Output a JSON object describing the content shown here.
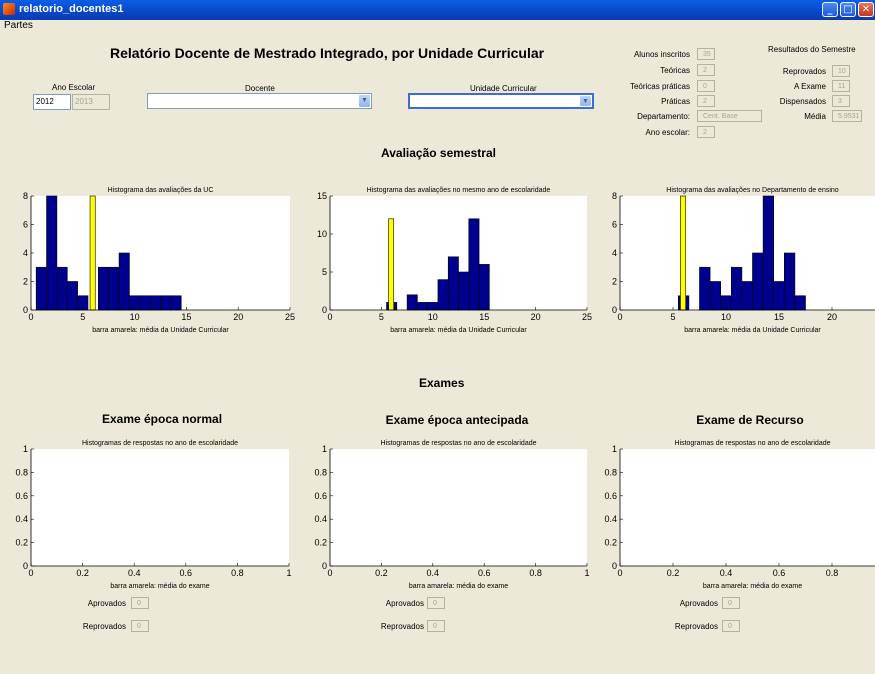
{
  "window": {
    "title": "relatorio_docentes1",
    "menu": "Partes"
  },
  "header": {
    "title": "Relatório Docente de Mestrado Integrado, por Unidade Curricular",
    "ano_escolar_label": "Ano Escolar",
    "ano_from": "2012",
    "ano_to": "2013",
    "docente_label": "Docente",
    "uc_label": "Unidade Curricular"
  },
  "stats": {
    "alunos_inscritos": {
      "label": "Alunos inscritos",
      "value": "35"
    },
    "teoricas": {
      "label": "Teóricas",
      "value": "2"
    },
    "teoricas_praticas": {
      "label": "Teóricas práticas",
      "value": "0"
    },
    "praticas": {
      "label": "Práticas",
      "value": "2"
    },
    "departamento": {
      "label": "Departamento:",
      "value": "Cent. Base"
    },
    "ano_escolar": {
      "label": "Ano escolar:",
      "value": "2"
    }
  },
  "resultados": {
    "title": "Resultados do Semestre",
    "reprovados": {
      "label": "Reprovados",
      "value": "10"
    },
    "a_exame": {
      "label": "A Exame",
      "value": "11"
    },
    "dispensados": {
      "label": "Dispensados",
      "value": "3"
    },
    "media": {
      "label": "Média",
      "value": "5.9531"
    }
  },
  "avaliacao": {
    "title": "Avaliação semestral"
  },
  "exames": {
    "title": "Exames",
    "panels": [
      {
        "title": "Exame época normal",
        "aprovados_label": "Aprovados",
        "aprovados": "0",
        "reprovados_label": "Reprovados",
        "reprovados": "0"
      },
      {
        "title": "Exame época antecipada",
        "aprovados_label": "Aprovados",
        "aprovados": "0",
        "reprovados_label": "Reprovados",
        "reprovados": "0"
      },
      {
        "title": "Exame de Recurso",
        "aprovados_label": "Aprovados",
        "aprovados": "0",
        "reprovados_label": "Reprovados",
        "reprovados": "0"
      }
    ]
  },
  "colors": {
    "bar": "#00008f",
    "bar_edge": "#000000",
    "mean": "#ffff00",
    "axes_bg": "#ffffff"
  },
  "chart_data": [
    {
      "type": "bar",
      "title": "Histograma das avaliações da UC",
      "xlabel": "barra amarela: média da Unidade Curricular",
      "xlim": [
        0,
        25
      ],
      "ylim": [
        0,
        8
      ],
      "xticks": [
        0,
        5,
        10,
        15,
        20,
        25
      ],
      "yticks": [
        0,
        2,
        4,
        6,
        8
      ],
      "bin_width": 1,
      "x": [
        1,
        2,
        3,
        4,
        5,
        7,
        8,
        9,
        10,
        11,
        12,
        13,
        14
      ],
      "values": [
        3,
        8,
        3,
        2,
        1,
        3,
        3,
        4,
        1,
        1,
        1,
        1,
        1
      ],
      "mean_line": {
        "x": 5.95,
        "height": 8
      }
    },
    {
      "type": "bar",
      "title": "Histograma das avaliações no mesmo ano de escolaridade",
      "xlabel": "barra amarela: média da Unidade Curricular",
      "xlim": [
        0,
        25
      ],
      "ylim": [
        0,
        15
      ],
      "xticks": [
        0,
        5,
        10,
        15,
        20,
        25
      ],
      "yticks": [
        0,
        5,
        10,
        15
      ],
      "bin_width": 1,
      "x": [
        6,
        8,
        9,
        10,
        11,
        12,
        14,
        15
      ],
      "values": [
        1,
        2,
        1,
        1,
        4,
        7,
        12,
        6
      ],
      "x2": [
        13
      ],
      "values2": [
        5
      ],
      "mean_line": {
        "x": 5.95,
        "height": 12
      }
    },
    {
      "type": "bar",
      "title": "Histograma das avaliações no Departamento de ensino",
      "xlabel": "barra amarela: média da Unidade Curricular",
      "xlim": [
        0,
        25
      ],
      "ylim": [
        0,
        8
      ],
      "xticks": [
        0,
        5,
        10,
        15,
        20
      ],
      "yticks": [
        0,
        2,
        4,
        6,
        8
      ],
      "bin_width": 1,
      "x": [
        6,
        8,
        9,
        10,
        11,
        12,
        13,
        14,
        15,
        16,
        17
      ],
      "values": [
        1,
        3,
        2,
        1,
        3,
        2,
        4,
        8,
        2,
        4,
        1
      ],
      "mean_line": {
        "x": 5.95,
        "height": 8
      }
    },
    {
      "type": "bar",
      "title": "Histogramas de respostas no ano de escolaridade",
      "xlabel": "barra amarela: média do exame",
      "xlim": [
        0,
        1
      ],
      "ylim": [
        0,
        1
      ],
      "xticks": [
        0,
        0.2,
        0.4,
        0.6,
        0.8,
        1
      ],
      "yticks": [
        0,
        0.2,
        0.4,
        0.6,
        0.8,
        1
      ],
      "x": [],
      "values": []
    },
    {
      "type": "bar",
      "title": "Histogramas de respostas no ano de escolaridade",
      "xlabel": "barra amarela: média do exame",
      "xlim": [
        0,
        1
      ],
      "ylim": [
        0,
        1
      ],
      "xticks": [
        0,
        0.2,
        0.4,
        0.6,
        0.8,
        1
      ],
      "yticks": [
        0,
        0.2,
        0.4,
        0.6,
        0.8,
        1
      ],
      "x": [],
      "values": []
    },
    {
      "type": "bar",
      "title": "Histogramas de respostas no ano de escolaridade",
      "xlabel": "barra amarela: média do exame",
      "xlim": [
        0,
        1
      ],
      "ylim": [
        0,
        1
      ],
      "xticks": [
        0,
        0.2,
        0.4,
        0.6,
        0.8
      ],
      "yticks": [
        0,
        0.2,
        0.4,
        0.6,
        0.8,
        1
      ],
      "x": [],
      "values": []
    }
  ]
}
